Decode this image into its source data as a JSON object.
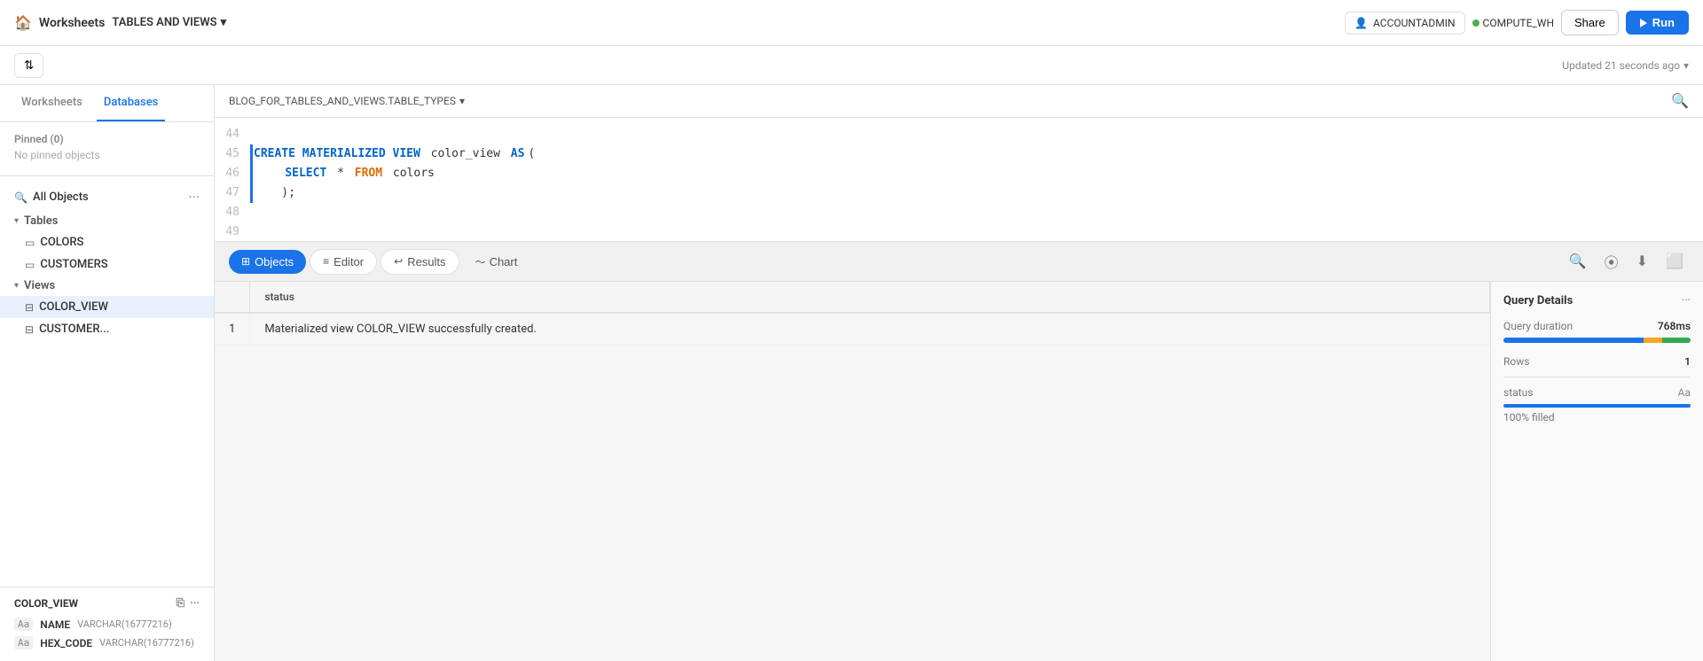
{
  "topNav": {
    "homeIcon": "🏠",
    "worksheetsLabel": "Worksheets",
    "tablesViewsLabel": "TABLES AND VIEWS",
    "dropdownIcon": "▾",
    "accountAdmin": "ACCOUNTADMIN",
    "computeWH": "COMPUTE_WH",
    "shareLabel": "Share",
    "runLabel": "Run"
  },
  "secondBar": {
    "updatedText": "Updated 21 seconds ago",
    "dropdownIcon": "▾"
  },
  "sidebar": {
    "worksheetsTab": "Worksheets",
    "databasesTab": "Databases",
    "pinnedTitle": "Pinned (0)",
    "noPinned": "No pinned objects",
    "allObjects": "All Objects",
    "tables": {
      "label": "Tables",
      "items": [
        "COLORS",
        "CUSTOMERS"
      ]
    },
    "views": {
      "label": "Views",
      "items": [
        "COLOR_VIEW",
        "CUSTOMER..."
      ]
    }
  },
  "footer": {
    "title": "COLOR_VIEW",
    "columns": [
      {
        "typeShort": "Aa",
        "name": "NAME",
        "type": "VARCHAR(16777216)"
      },
      {
        "typeShort": "Aa",
        "name": "HEX_CODE",
        "type": "VARCHAR(16777216)"
      }
    ]
  },
  "codeHeader": {
    "breadcrumb": "BLOG_FOR_TABLES_AND_VIEWS.TABLE_TYPES",
    "dropdownIcon": "▾"
  },
  "codeEditor": {
    "lines": [
      {
        "num": "44",
        "content": "",
        "active": false
      },
      {
        "num": "45",
        "content": "CREATE MATERIALIZED VIEW color_view AS(",
        "active": true,
        "tokens": [
          {
            "t": "kw-blue",
            "v": "CREATE MATERIALIZED VIEW"
          },
          {
            "t": "plain",
            "v": " color_view "
          },
          {
            "t": "kw-blue",
            "v": "AS"
          },
          {
            "t": "plain",
            "v": "("
          }
        ]
      },
      {
        "num": "46",
        "content": "    SELECT * FROM colors",
        "active": true,
        "tokens": [
          {
            "t": "plain",
            "v": "    "
          },
          {
            "t": "kw-blue",
            "v": "SELECT"
          },
          {
            "t": "plain",
            "v": " * "
          },
          {
            "t": "kw-orange",
            "v": "FROM"
          },
          {
            "t": "plain",
            "v": " colors"
          }
        ]
      },
      {
        "num": "47",
        "content": ");",
        "active": true,
        "tokens": [
          {
            "t": "plain",
            "v": "    );"
          }
        ]
      },
      {
        "num": "48",
        "content": "",
        "active": false
      },
      {
        "num": "49",
        "content": "",
        "active": false
      }
    ]
  },
  "tabs": {
    "objects": "Objects",
    "editor": "Editor",
    "results": "Results",
    "chart": "Chart"
  },
  "resultsTable": {
    "columns": [
      "status"
    ],
    "rows": [
      {
        "rowNum": "1",
        "status": "Materialized view COLOR_VIEW successfully created."
      }
    ]
  },
  "queryDetails": {
    "title": "Query Details",
    "queryDurationLabel": "Query duration",
    "queryDurationValue": "768ms",
    "rowsLabel": "Rows",
    "rowsValue": "1",
    "statusLabel": "status",
    "statusAa": "Aa",
    "filledLabel": "100% filled",
    "progressBlue": 75,
    "progressOrange": 10,
    "progressGreen": 15
  }
}
